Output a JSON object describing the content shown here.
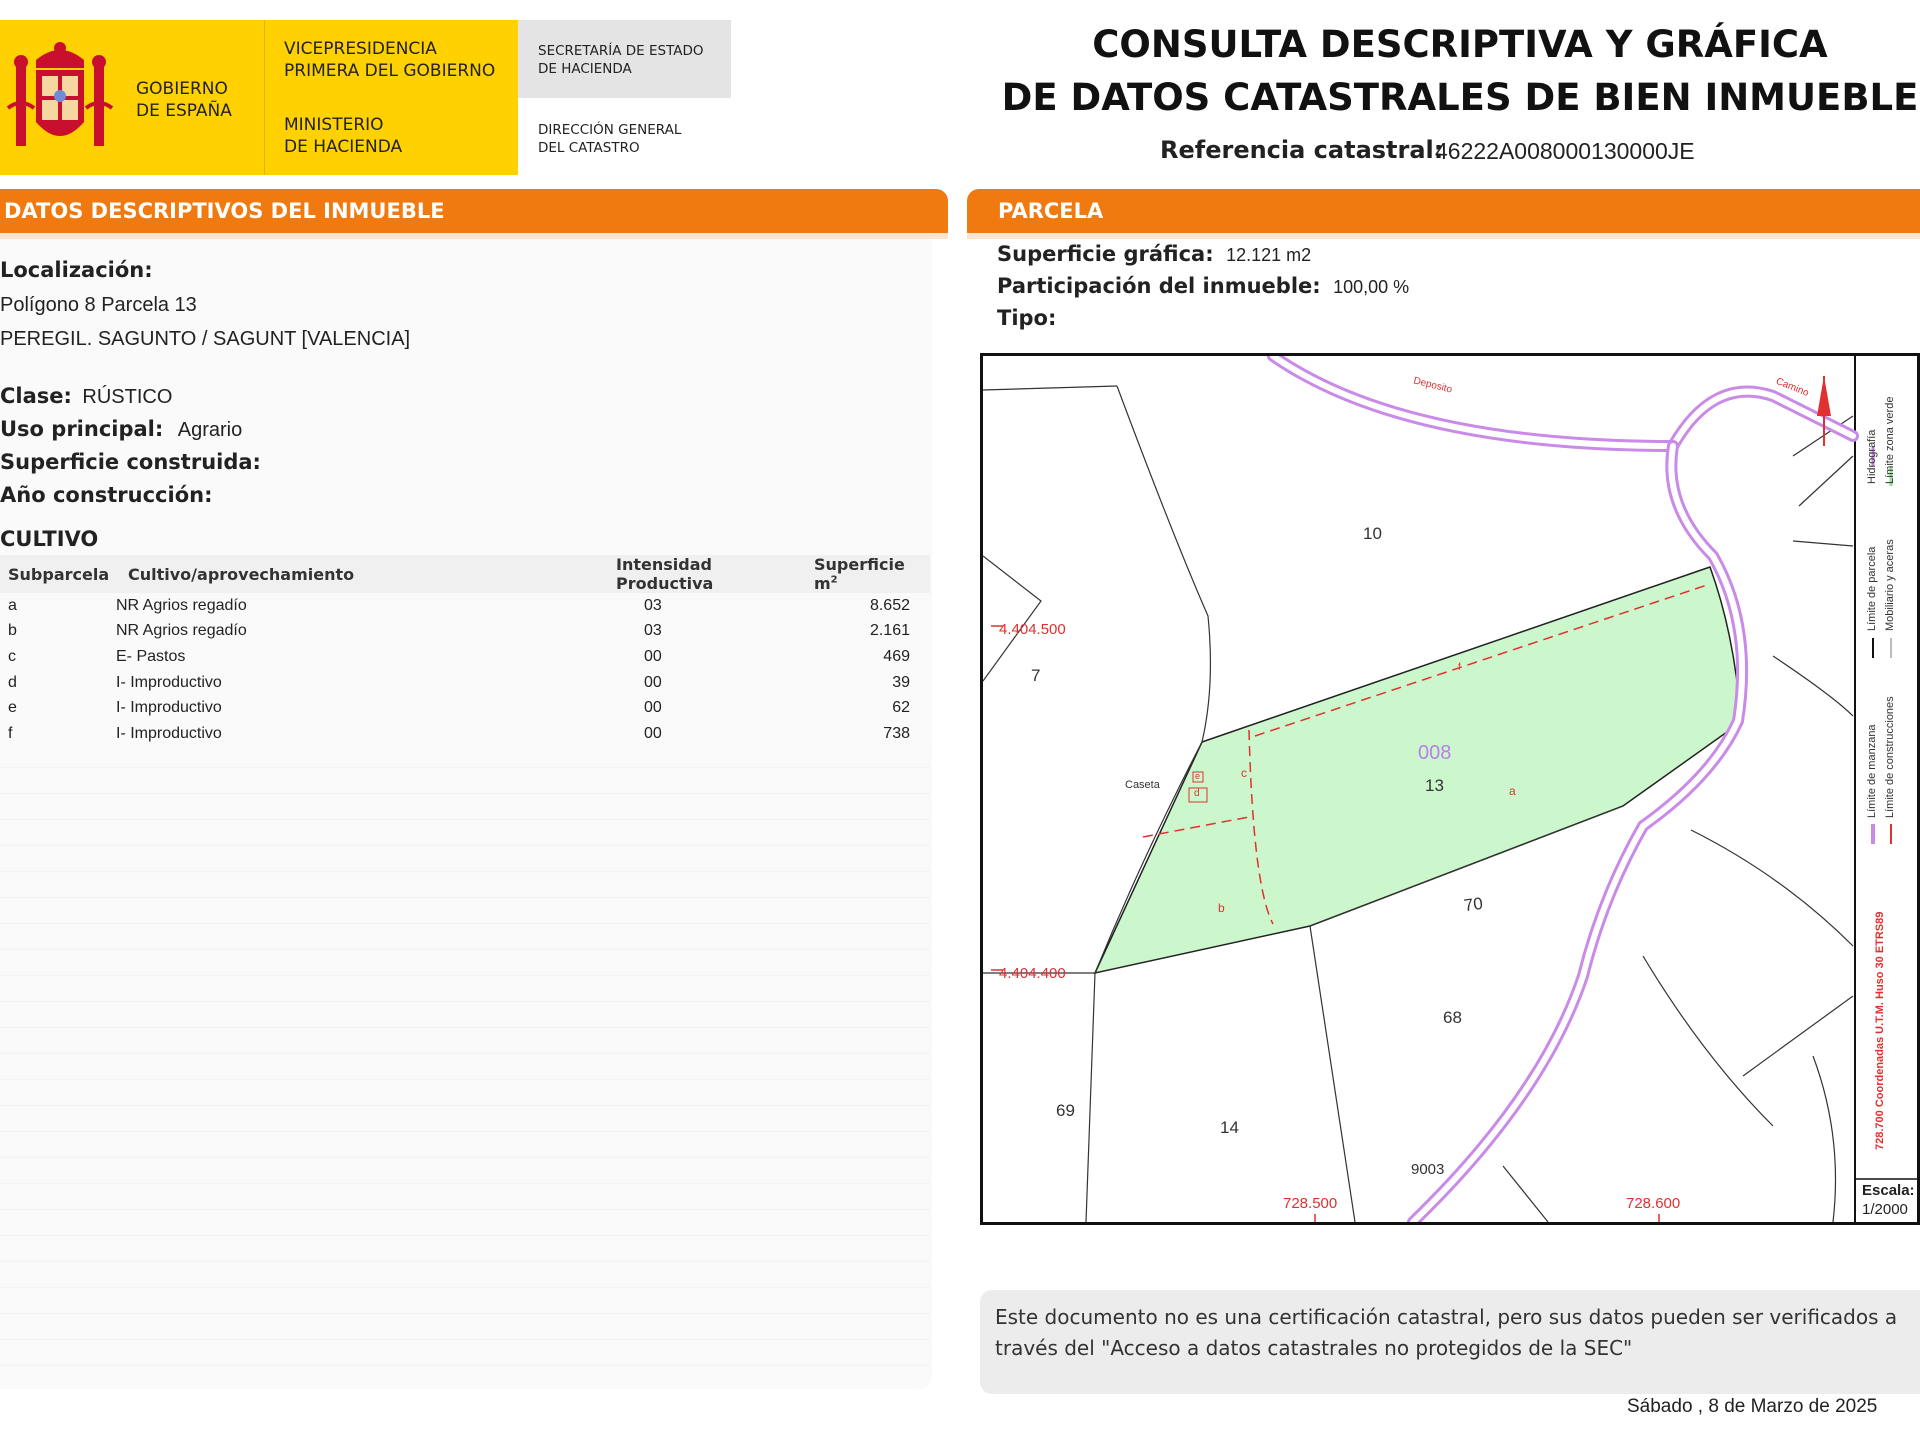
{
  "header": {
    "gobierno": "GOBIERNO\nDE ESPAÑA",
    "vicepresidencia": "VICEPRESIDENCIA\nPRIMERA DEL GOBIERNO",
    "ministerio": "MINISTERIO\nDE HACIENDA",
    "secretaria": "SECRETARÍA DE ESTADO\nDE HACIENDA",
    "direccion": "DIRECCIÓN GENERAL\nDEL CATASTRO",
    "title_line1": "CONSULTA DESCRIPTIVA Y GRÁFICA",
    "title_line2": "DE DATOS CATASTRALES DE BIEN INMUEBLE",
    "ref_label": "Referencia catastral:",
    "ref_value": "46222A008000130000JE"
  },
  "descriptivos": {
    "section_title": "DATOS DESCRIPTIVOS DEL INMUEBLE",
    "localizacion_label": "Localización:",
    "localizacion_line1": "Polígono 8 Parcela 13",
    "localizacion_line2": "PEREGIL. SAGUNTO / SAGUNT [VALENCIA]",
    "clase_label": "Clase:",
    "clase_value": "RÚSTICO",
    "uso_label": "Uso principal:",
    "uso_value": "Agrario",
    "superficie_construida_label": "Superficie construida:",
    "ano_label": "Año construcción:"
  },
  "cultivo": {
    "title": "CULTIVO",
    "headers": [
      "Subparcela",
      "Cultivo/aprovechamiento",
      "Intensidad Productiva",
      "Superficie m"
    ],
    "header_sup": "2",
    "rows": [
      [
        "a",
        "NR Agrios regadío",
        "03",
        "8.652"
      ],
      [
        "b",
        "NR Agrios regadío",
        "03",
        "2.161"
      ],
      [
        "c",
        "E- Pastos",
        "00",
        "469"
      ],
      [
        "d",
        "I- Improductivo",
        "00",
        "39"
      ],
      [
        "e",
        "I- Improductivo",
        "00",
        "62"
      ],
      [
        "f",
        "I- Improductivo",
        "00",
        "738"
      ]
    ]
  },
  "parcela": {
    "section_title": "PARCELA",
    "superficie_label": "Superficie gráfica:",
    "superficie_value": "12.121 m2",
    "participacion_label": "Participación del inmueble:",
    "participacion_value": "100,00 %",
    "tipo_label": "Tipo:"
  },
  "map": {
    "parcel_colors": {
      "highlight": "#ccf7cc",
      "road": "#c98ae8",
      "red": "#e03030"
    },
    "labels": {
      "deposito": "Deposito",
      "camino": "Camino",
      "p10": "10",
      "p7": "7",
      "p008": "008",
      "p13": "13",
      "caseta": "Caseta",
      "p70": "70",
      "p68": "68",
      "p69": "69",
      "p14": "14",
      "p9003": "9003",
      "sub_a": "a",
      "sub_b": "b",
      "sub_c": "c",
      "sub_d": "d",
      "sub_e": "e",
      "sub_f": "f",
      "y1": "4.404.500",
      "y2": "4.404.400",
      "x1": "728.500",
      "x2": "728.600"
    },
    "legend": {
      "hidrografia": "Hidrografía",
      "limite_zona_verde": "Límite zona verde",
      "limite_parcela": "Límite de parcela",
      "mobiliario": "Mobiliario y aceras",
      "limite_manzana": "Límite de manzana",
      "limite_construcciones": "Límite de construcciones",
      "coordenadas": "728.700 Coordenadas U.T.M. Huso 30 ETRS89"
    },
    "escala_label": "Escala:",
    "escala_value": "1/2000"
  },
  "footer": {
    "notice": "Este documento no es una certificación catastral, pero sus datos pueden ser verificados a través del \"Acceso a datos catastrales no protegidos de la SEC\"",
    "date": "Sábado , 8 de Marzo de 2025"
  }
}
